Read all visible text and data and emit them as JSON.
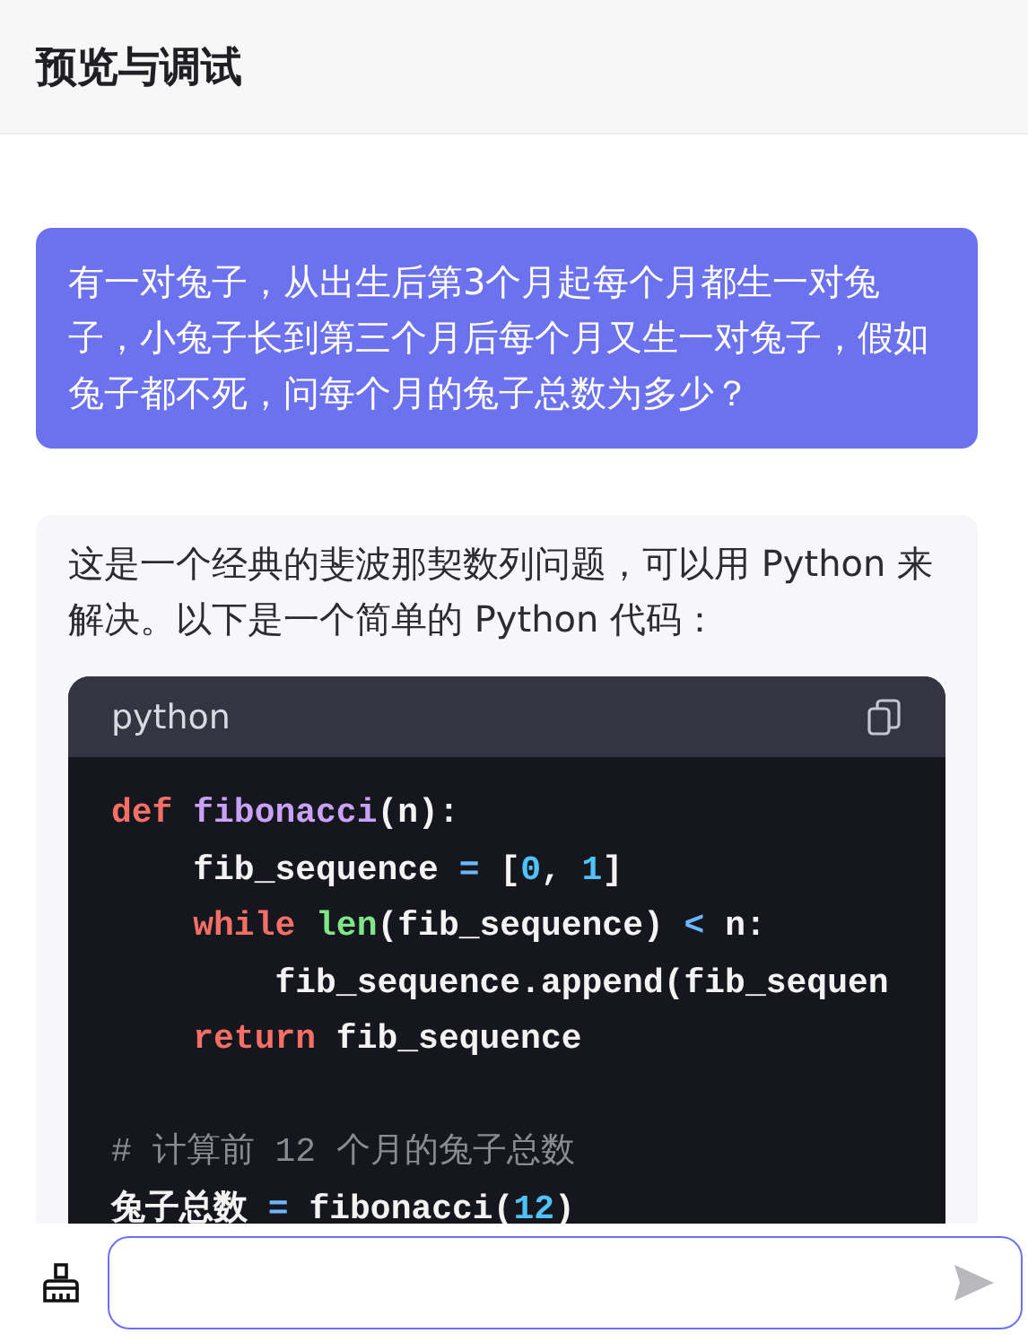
{
  "header": {
    "title": "预览与调试"
  },
  "messages": [
    {
      "kind": "user",
      "text": "有一对兔子，从出生后第3个月起每个月都生一对兔子，小兔子长到第三个月后每个月又生一对兔子，假如兔子都不死，问每个月的兔子总数为多少？"
    },
    {
      "kind": "assistant",
      "text": "这是一个经典的斐波那契数列问题，可以用 Python 来解决。以下是一个简单的 Python 代码：",
      "code": {
        "language": "python",
        "lines": [
          {
            "kind": "code",
            "tokens": [
              {
                "kind": "keyword",
                "text": "def "
              },
              {
                "kind": "function",
                "text": "fibonacci"
              },
              {
                "kind": "plain",
                "text": "(n):"
              }
            ]
          },
          {
            "kind": "code",
            "tokens": [
              {
                "kind": "plain",
                "text": "    fib_sequence "
              },
              {
                "kind": "operator",
                "text": "="
              },
              {
                "kind": "plain",
                "text": " ["
              },
              {
                "kind": "number",
                "text": "0"
              },
              {
                "kind": "plain",
                "text": ", "
              },
              {
                "kind": "number",
                "text": "1"
              },
              {
                "kind": "plain",
                "text": "]"
              }
            ]
          },
          {
            "kind": "code",
            "tokens": [
              {
                "kind": "keyword",
                "text": "    while "
              },
              {
                "kind": "builtin",
                "text": "len"
              },
              {
                "kind": "plain",
                "text": "(fib_sequence) "
              },
              {
                "kind": "operator",
                "text": "<"
              },
              {
                "kind": "plain",
                "text": " n:"
              }
            ]
          },
          {
            "kind": "code",
            "tokens": [
              {
                "kind": "plain",
                "text": "        fib_sequence.append(fib_sequen"
              }
            ]
          },
          {
            "kind": "code",
            "tokens": [
              {
                "kind": "keyword",
                "text": "    return"
              },
              {
                "kind": "plain",
                "text": " fib_sequence"
              }
            ]
          },
          {
            "kind": "blank"
          },
          {
            "kind": "code",
            "tokens": [
              {
                "kind": "comment",
                "text": "# 计算前 12 个月的兔子总数"
              }
            ]
          },
          {
            "kind": "code",
            "tokens": [
              {
                "kind": "plain",
                "text": "兔子总数 "
              },
              {
                "kind": "operator",
                "text": "="
              },
              {
                "kind": "plain",
                "text": " fibonacci("
              },
              {
                "kind": "number",
                "text": "12"
              },
              {
                "kind": "plain",
                "text": ")"
              }
            ]
          }
        ]
      }
    }
  ],
  "composer": {
    "focused": true
  }
}
